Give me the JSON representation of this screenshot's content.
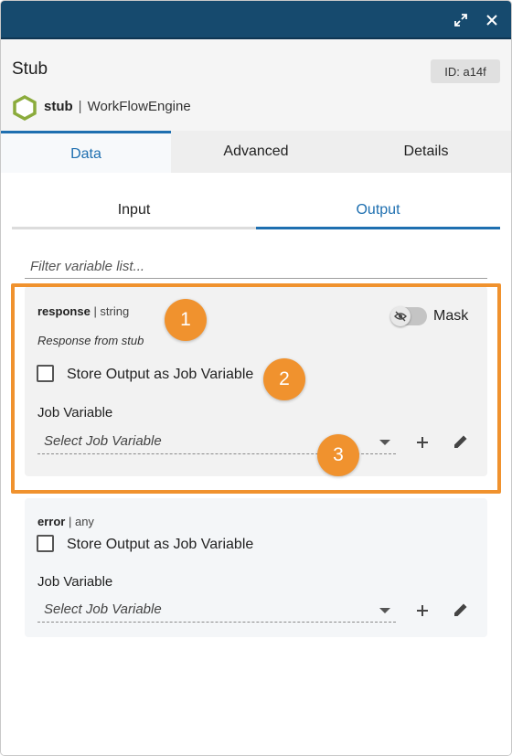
{
  "window": {
    "title": "Stub",
    "id_badge": "ID: a14f",
    "accent": "#164a6e"
  },
  "header": {
    "step_name": "stub",
    "separator": "|",
    "engine": "WorkFlowEngine",
    "icon": "hexagon-icon",
    "icon_color": "#8bab3c"
  },
  "tabs": [
    {
      "label": "Data",
      "active": true
    },
    {
      "label": "Advanced",
      "active": false
    },
    {
      "label": "Details",
      "active": false
    }
  ],
  "subtabs": [
    {
      "label": "Input",
      "active": false
    },
    {
      "label": "Output",
      "active": true
    }
  ],
  "filter": {
    "placeholder": "Filter variable list...",
    "value": ""
  },
  "outputs": [
    {
      "name": "response",
      "type": "| string",
      "description": "Response from stub",
      "mask_label": "Mask",
      "mask_on": false,
      "store_label": "Store Output as Job Variable",
      "store_checked": false,
      "job_variable_label": "Job Variable",
      "select_placeholder": "Select Job Variable"
    },
    {
      "name": "error",
      "type": "| any",
      "store_label": "Store Output as Job Variable",
      "store_checked": false,
      "job_variable_label": "Job Variable",
      "select_placeholder": "Select Job Variable"
    }
  ],
  "callouts": [
    "1",
    "2",
    "3"
  ],
  "colors": {
    "active_tab": "#1e6fb0",
    "callout": "#f0922e",
    "highlight": "#f0922e"
  }
}
